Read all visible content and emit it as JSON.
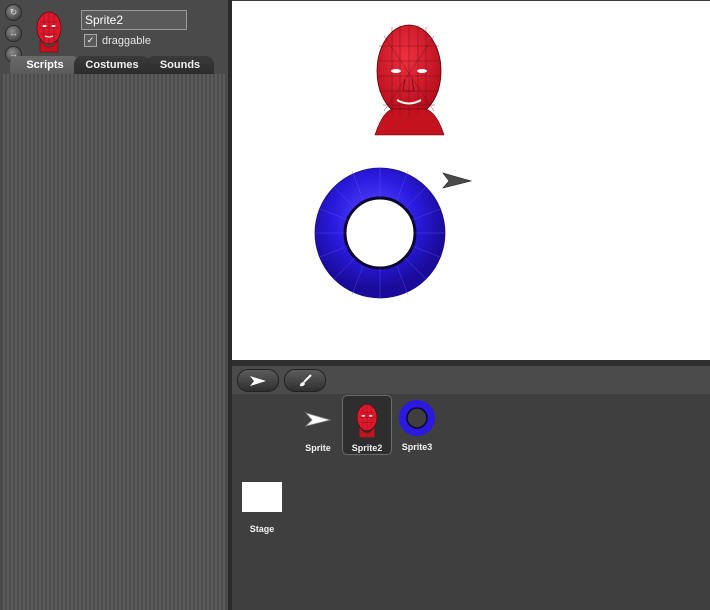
{
  "sprite_info": {
    "name": "Sprite2",
    "draggable_label": "draggable",
    "draggable_checked": true,
    "check_glyph": "✓"
  },
  "rotation_controls": [
    {
      "icon": "rotate-icon",
      "glyph": "↻"
    },
    {
      "icon": "left-right-icon",
      "glyph": "↔"
    },
    {
      "icon": "no-rotate-icon",
      "glyph": "→"
    }
  ],
  "tabs": [
    {
      "label": "Scripts",
      "active": true
    },
    {
      "label": "Costumes",
      "active": false
    },
    {
      "label": "Sounds",
      "active": false
    }
  ],
  "stage": {
    "sprites": [
      "face-head-sprite",
      "torus-ring-sprite",
      "arrow-sprite"
    ],
    "colors": {
      "head": "#dd1a2c",
      "torus": "#2a1adf",
      "arrow": "#4a4a4a"
    }
  },
  "toolbar": {
    "buttons": [
      "arrow-icon",
      "paintbrush-icon"
    ]
  },
  "corral": {
    "sprites": [
      {
        "label": "Sprite",
        "selected": false
      },
      {
        "label": "Sprite2",
        "selected": true
      },
      {
        "label": "Sprite3",
        "selected": false
      }
    ],
    "stage_label": "Stage"
  }
}
